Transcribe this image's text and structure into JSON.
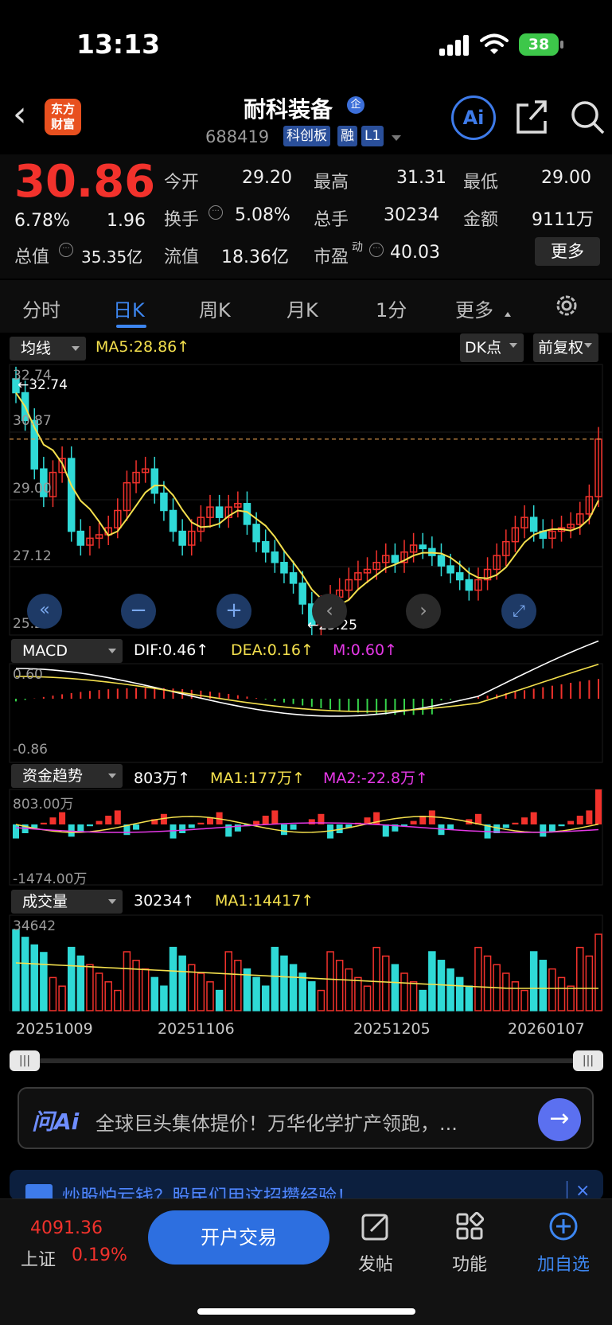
{
  "status": {
    "time": "13:13",
    "battery": "38"
  },
  "header": {
    "logo_line1": "东方",
    "logo_line2": "财富",
    "stock_name": "耐科装备",
    "qiye_badge": "企",
    "code": "688419",
    "tags": [
      "科创板",
      "融",
      "L1"
    ],
    "ai_label": "Ai"
  },
  "quote": {
    "price": "30.86",
    "change_pct": "6.78%",
    "change": "1.96",
    "open_label": "今开",
    "open": "29.20",
    "high_label": "最高",
    "high": "31.31",
    "low_label": "最低",
    "low": "29.00",
    "turnover_label": "换手",
    "turnover": "5.08%",
    "volume_label": "总手",
    "volume": "30234",
    "amount_label": "金额",
    "amount": "9111万",
    "mktcap_label": "总值",
    "mktcap": "35.35亿",
    "float_label": "流值",
    "float": "18.36亿",
    "pe_label": "市盈",
    "pe_sup": "动",
    "pe": "40.03",
    "more": "更多"
  },
  "tabs": [
    {
      "label": "分时",
      "active": false
    },
    {
      "label": "日K",
      "active": true
    },
    {
      "label": "周K",
      "active": false
    },
    {
      "label": "月K",
      "active": false
    },
    {
      "label": "1分",
      "active": false
    },
    {
      "label": "更多",
      "active": false
    }
  ],
  "kline_panel": {
    "select": "均线",
    "ma5": "MA5:28.86↑",
    "dk_button": "DK点",
    "fq_button": "前复权",
    "y_ticks": [
      "32.74",
      "30.87",
      "29.00",
      "27.12",
      "25.25"
    ],
    "max_marker": "←32.74",
    "min_marker": "←25.25"
  },
  "macd_panel": {
    "select": "MACD",
    "dif": "DIF:0.46↑",
    "dea": "DEA:0.16↑",
    "m": "M:0.60↑",
    "top": "0.60",
    "bottom": "-0.86"
  },
  "fund_panel": {
    "select": "资金趋势",
    "value": "803万↑",
    "ma1": "MA1:177万↑",
    "ma2": "MA2:-22.8万↑",
    "top": "803.00万",
    "bottom": "-1474.00万"
  },
  "volume_panel": {
    "select": "成交量",
    "value": "30234↑",
    "ma1": "MA1:14417↑",
    "top": "34642"
  },
  "x_dates": [
    "20251009",
    "20251106",
    "20251205",
    "20260107"
  ],
  "chart_data": {
    "type": "candlestick",
    "title": "",
    "ylim": [
      25.25,
      32.74
    ],
    "last_close": 30.86,
    "ma5_last": 28.86,
    "high_marker": 32.74,
    "low_marker": 25.25,
    "x_labels": [
      "20251009",
      "20251106",
      "20251205",
      "20260107"
    ],
    "volume_max": 34642,
    "volume_last": 30234,
    "macd": {
      "dif": 0.46,
      "dea": 0.16,
      "m": 0.6,
      "range": [
        -0.86,
        0.6
      ]
    },
    "fund_trend": {
      "value_wan": 803,
      "ma1_wan": 177,
      "ma2_wan": -22.8,
      "range_wan": [
        -1474.0,
        803.0
      ]
    }
  },
  "colors": {
    "up": "#f2322c",
    "down": "#2fd9d6",
    "ma_yellow": "#f4e04d",
    "accent": "#3d86f0"
  },
  "ask": {
    "label": "问Ai",
    "text": "全球巨头集体提价！万华化学扩产领跑，..."
  },
  "banner": {
    "text": "炒股怕亏钱？股民们用这招攒经验！"
  },
  "nav": {
    "index_value": "4091.36",
    "index_name": "上证",
    "index_change": "0.19%",
    "trade_button": "开户交易",
    "post": "发帖",
    "features": "功能",
    "add_watch": "加自选"
  }
}
